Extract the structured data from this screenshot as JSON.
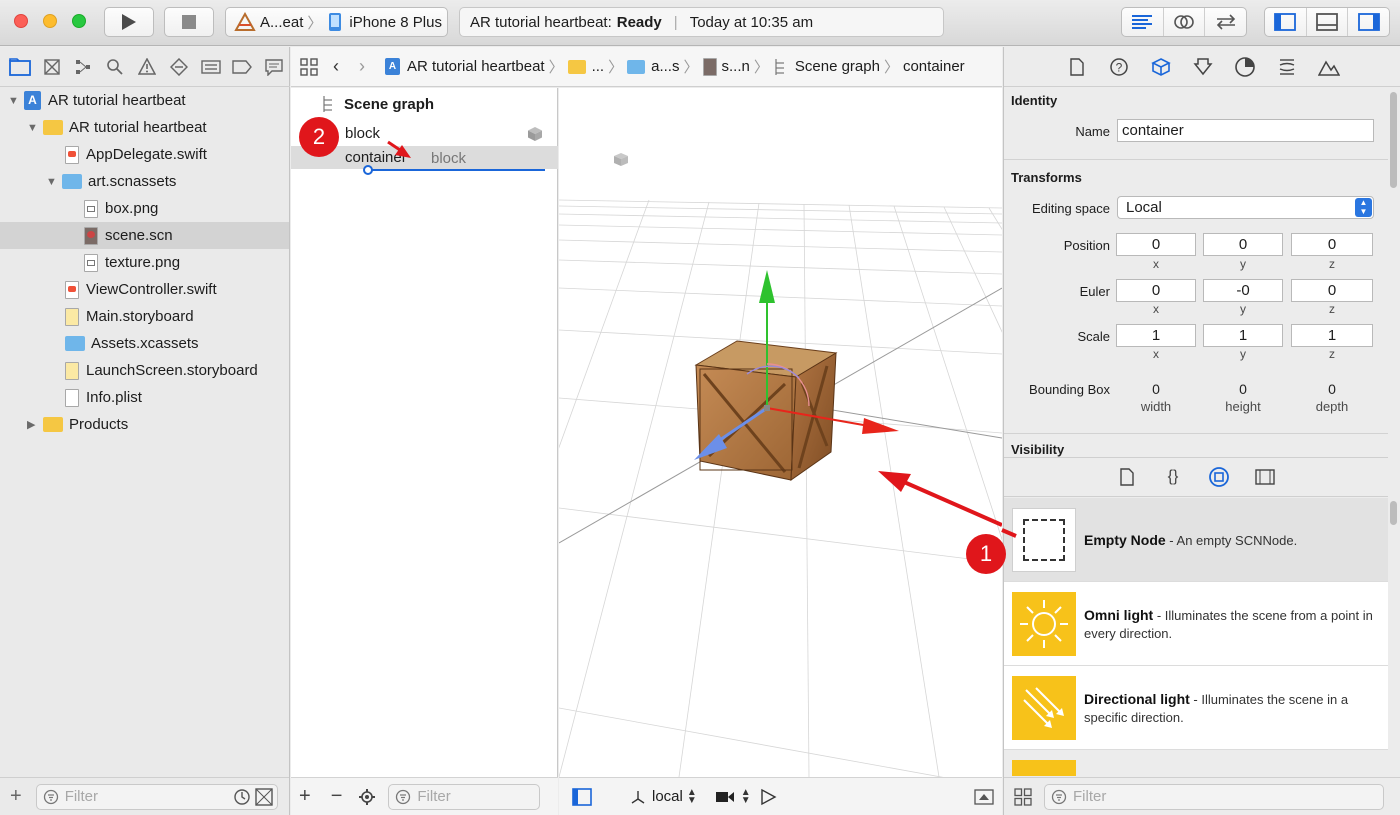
{
  "toolbar": {
    "scheme_target": "A...eat",
    "scheme_device": "iPhone 8 Plus",
    "status_project": "AR tutorial heartbeat:",
    "status_state": "Ready",
    "status_time": "Today at 10:35 am"
  },
  "navigator": {
    "tree": [
      {
        "label": "AR tutorial heartbeat",
        "kind": "project",
        "level": 0,
        "expanded": true
      },
      {
        "label": "AR tutorial heartbeat",
        "kind": "folder",
        "level": 1,
        "expanded": true
      },
      {
        "label": "AppDelegate.swift",
        "kind": "swift",
        "level": 2
      },
      {
        "label": "art.scnassets",
        "kind": "blue-folder",
        "level": 2,
        "expanded": true
      },
      {
        "label": "box.png",
        "kind": "image",
        "level": 3
      },
      {
        "label": "scene.scn",
        "kind": "scene",
        "level": 3,
        "selected": true
      },
      {
        "label": "texture.png",
        "kind": "image",
        "level": 3
      },
      {
        "label": "ViewController.swift",
        "kind": "swift",
        "level": 2
      },
      {
        "label": "Main.storyboard",
        "kind": "storyboard",
        "level": 2
      },
      {
        "label": "Assets.xcassets",
        "kind": "blue-folder",
        "level": 2
      },
      {
        "label": "LaunchScreen.storyboard",
        "kind": "storyboard",
        "level": 2
      },
      {
        "label": "Info.plist",
        "kind": "plist",
        "level": 2
      },
      {
        "label": "Products",
        "kind": "folder",
        "level": 1,
        "expanded": false
      }
    ],
    "filter_placeholder": "Filter"
  },
  "jumpbar": {
    "crumbs": [
      "AR tutorial heartbeat",
      "...",
      "a...s",
      "s...n",
      "Scene graph",
      "container"
    ]
  },
  "scene_graph": {
    "title": "Scene graph",
    "nodes": [
      "block",
      "container"
    ],
    "drag_label": "block",
    "filter_placeholder": "Filter"
  },
  "viewport": {
    "space": "local"
  },
  "inspector": {
    "identity_title": "Identity",
    "name_label": "Name",
    "name_value": "container",
    "transforms_title": "Transforms",
    "editing_space_label": "Editing space",
    "editing_space_value": "Local",
    "position_label": "Position",
    "euler_label": "Euler",
    "scale_label": "Scale",
    "bounding_label": "Bounding Box",
    "position": [
      "0",
      "0",
      "0"
    ],
    "euler": [
      "0",
      "-0",
      "0"
    ],
    "scale": [
      "1",
      "1",
      "1"
    ],
    "axis": [
      "x",
      "y",
      "z"
    ],
    "bounding": [
      "0",
      "0",
      "0"
    ],
    "bounding_axis": [
      "width",
      "height",
      "depth"
    ],
    "visibility_title": "Visibility"
  },
  "library": {
    "items": [
      {
        "name": "Empty Node",
        "desc": " - An empty SCNNode."
      },
      {
        "name": "Omni light",
        "desc": " - Illuminates the scene from a point in every direction."
      },
      {
        "name": "Directional light",
        "desc": " - Illuminates the scene in a specific direction."
      }
    ],
    "filter_placeholder": "Filter"
  },
  "annotations": [
    "1",
    "2"
  ],
  "colors": {
    "accent_blue": "#1a66d9",
    "badge_red": "#e0161b",
    "light_yellow": "#f7c21a"
  }
}
